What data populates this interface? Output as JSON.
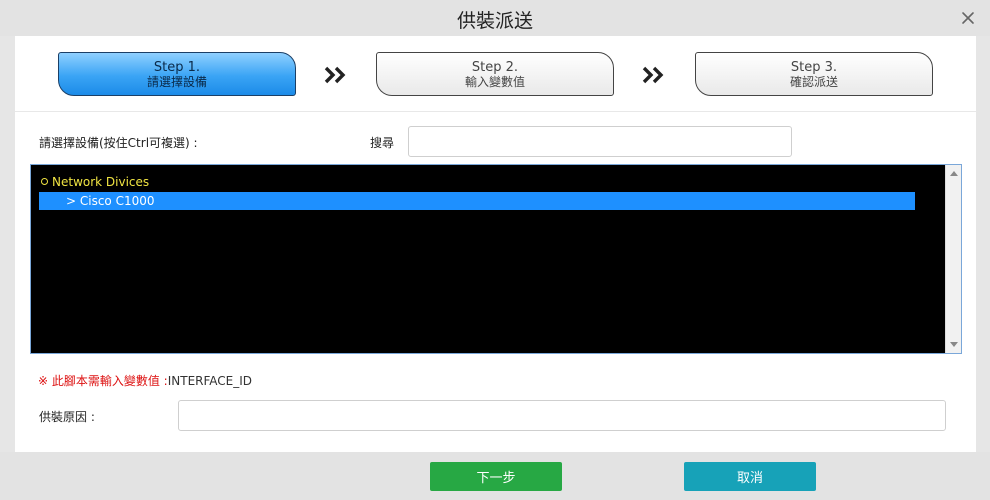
{
  "dialog": {
    "title": "供裝派送",
    "close_icon": "close-icon"
  },
  "steps": [
    {
      "num": "Step 1.",
      "label": "請選擇設備",
      "active": true
    },
    {
      "num": "Step 2.",
      "label": "輸入變數值",
      "active": false
    },
    {
      "num": "Step 3.",
      "label": "確認派送",
      "active": false
    }
  ],
  "select": {
    "label": "請選擇設備(按住Ctrl可複選) :"
  },
  "search": {
    "label": "搜尋",
    "value": "",
    "placeholder": ""
  },
  "tree": {
    "root": "Network Divices",
    "children": [
      {
        "label": "> Cisco C1000",
        "selected": true
      }
    ]
  },
  "notice": {
    "warning": "※ 此腳本需輸入變數值 :",
    "variable": "INTERFACE_ID"
  },
  "reason": {
    "label": "供裝原因 :",
    "value": "",
    "placeholder": ""
  },
  "buttons": {
    "next": "下一步",
    "cancel": "取消"
  },
  "colors": {
    "active_step": "#1c8be8",
    "tree_background": "#000000",
    "tree_root_text": "#f0e442",
    "tree_selection": "#1e90ff",
    "warning_text": "#dd1111",
    "next_button": "#27a844",
    "cancel_button": "#17a2b8"
  }
}
